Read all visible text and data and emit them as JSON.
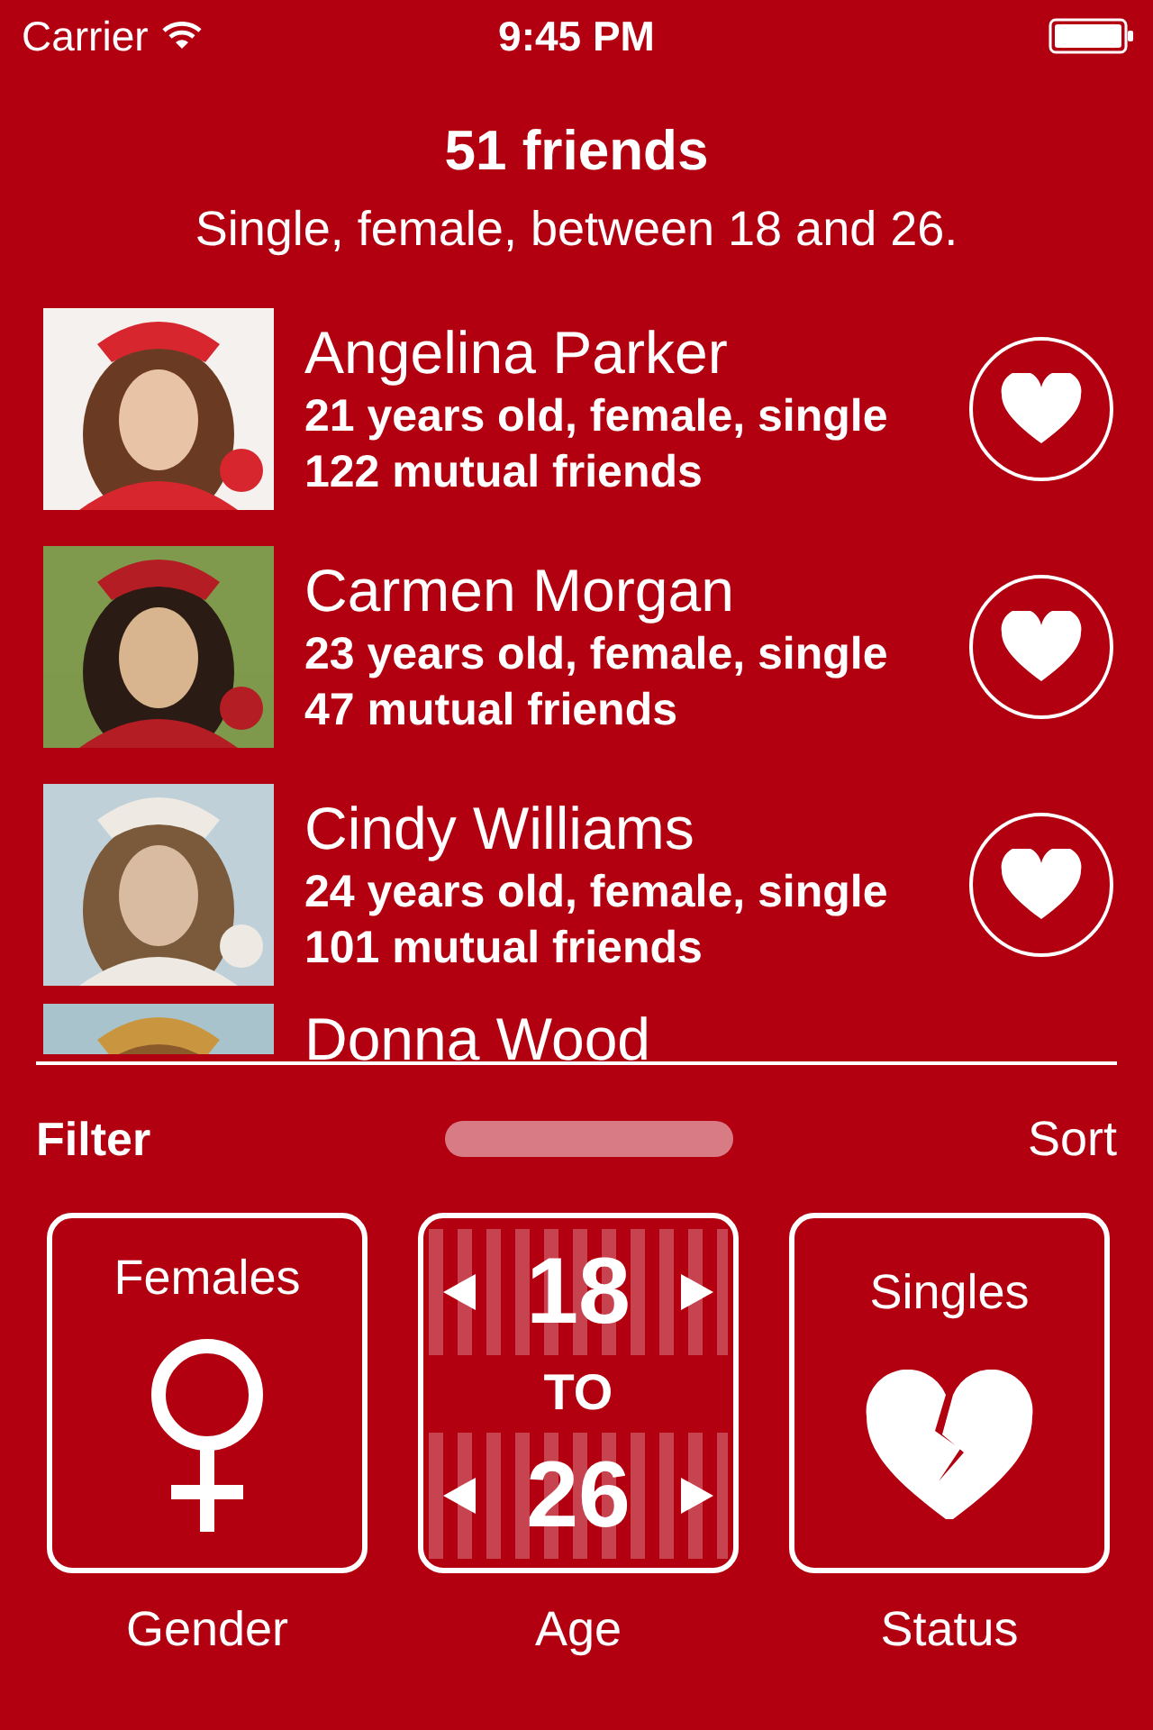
{
  "status_bar": {
    "carrier": "Carrier",
    "time": "9:45 PM"
  },
  "header": {
    "title": "51 friends",
    "subtitle": "Single, female, between 18 and 26."
  },
  "friends": [
    {
      "name": "Angelina Parker",
      "details": "21 years old, female, single",
      "mutual": "122 mutual friends"
    },
    {
      "name": "Carmen Morgan",
      "details": "23 years old, female, single",
      "mutual": "47 mutual friends"
    },
    {
      "name": "Cindy Williams",
      "details": "24 years old, female, single",
      "mutual": "101 mutual friends"
    },
    {
      "name": "Donna Wood"
    }
  ],
  "toolbar": {
    "filter": "Filter",
    "sort": "Sort"
  },
  "filters": [
    {
      "kind": "gender",
      "value": "Females",
      "label": "Gender"
    },
    {
      "kind": "age",
      "from": "18",
      "joiner": "TO",
      "to": "26",
      "label": "Age"
    },
    {
      "kind": "status",
      "value": "Singles",
      "label": "Status"
    }
  ]
}
